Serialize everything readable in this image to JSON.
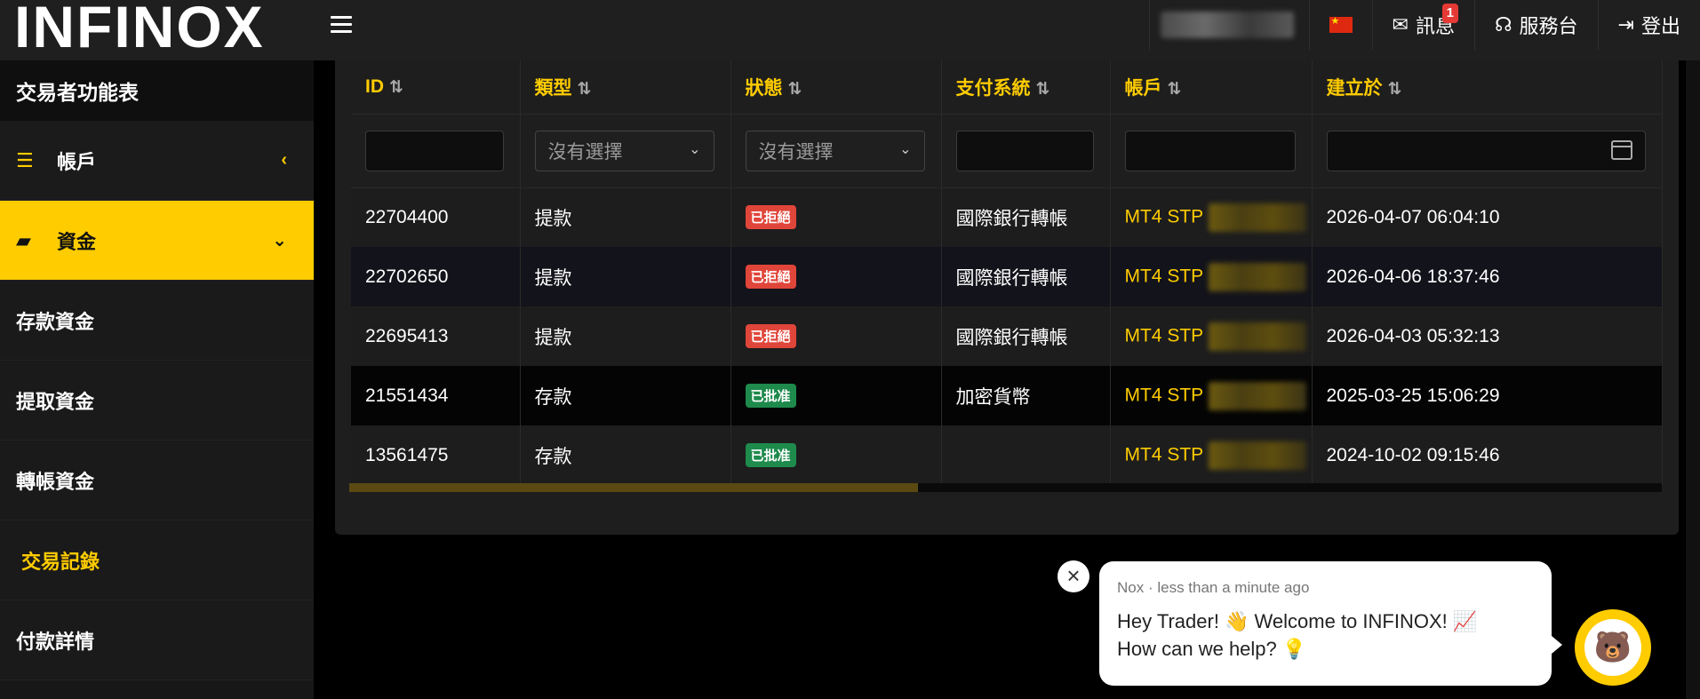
{
  "brand": {
    "logo_text": "INFINOX"
  },
  "header": {
    "message_label": "訊息",
    "message_count": "1",
    "support_label": "服務台",
    "logout_label": "登出"
  },
  "sidebar": {
    "title": "交易者功能表",
    "items": [
      {
        "label": "帳戶",
        "icon": "list-icon",
        "chevron": "‹"
      },
      {
        "label": "資金",
        "icon": "wallet-icon",
        "chevron": "⌄"
      },
      {
        "label": "存款資金"
      },
      {
        "label": "提取資金"
      },
      {
        "label": "轉帳資金"
      },
      {
        "label": "交易記錄"
      },
      {
        "label": "付款詳情"
      }
    ]
  },
  "table": {
    "columns": [
      "ID",
      "類型",
      "狀態",
      "支付系統",
      "帳戶",
      "建立於"
    ],
    "filters": {
      "type_placeholder": "沒有選擇",
      "status_placeholder": "沒有選擇"
    },
    "rows": [
      {
        "id": "22704400",
        "type": "提款",
        "status": "已拒絕",
        "status_kind": "rejected",
        "payment": "國際銀行轉帳",
        "account": "MT4 STP",
        "created": "2026-04-07 06:04:10"
      },
      {
        "id": "22702650",
        "type": "提款",
        "status": "已拒絕",
        "status_kind": "rejected",
        "payment": "國際銀行轉帳",
        "account": "MT4 STP",
        "created": "2026-04-06 18:37:46"
      },
      {
        "id": "22695413",
        "type": "提款",
        "status": "已拒絕",
        "status_kind": "rejected",
        "payment": "國際銀行轉帳",
        "account": "MT4 STP",
        "created": "2026-04-03 05:32:13"
      },
      {
        "id": "21551434",
        "type": "存款",
        "status": "已批准",
        "status_kind": "approved",
        "payment": "加密貨幣",
        "account": "MT4 STP",
        "created": "2025-03-25 15:06:29"
      },
      {
        "id": "13561475",
        "type": "存款",
        "status": "已批准",
        "status_kind": "approved",
        "payment": "",
        "account": "MT4 STP",
        "created": "2024-10-02 09:15:46"
      }
    ]
  },
  "chat": {
    "meta": "Nox · less than a minute ago",
    "line1": "Hey Trader! 👋 Welcome to INFINOX! 📈",
    "line2": "How can we help? 💡"
  },
  "colors": {
    "accent": "#ffcc00",
    "rejected": "#e0453a",
    "approved": "#1e8a4c"
  }
}
